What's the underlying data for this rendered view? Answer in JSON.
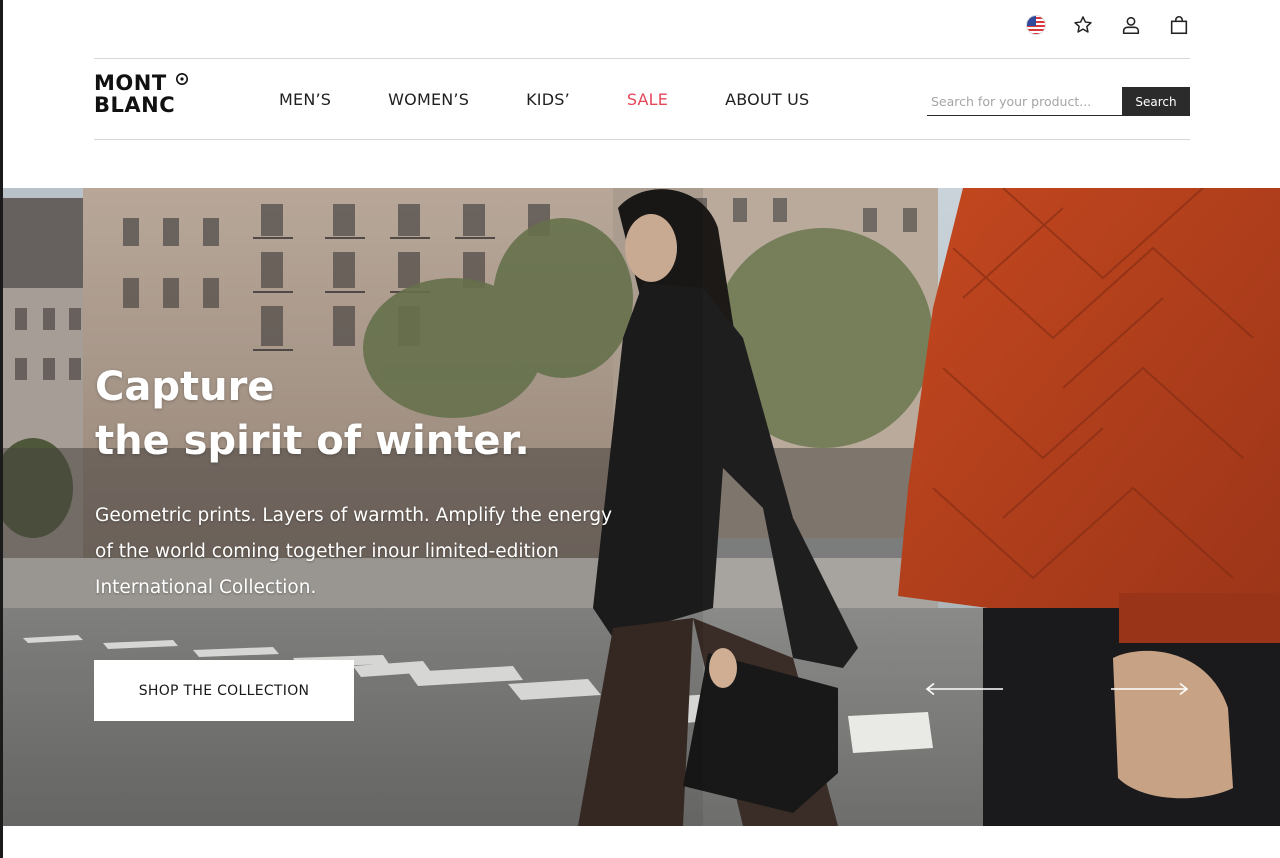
{
  "utility": {
    "icons": [
      "us-flag-icon",
      "star-icon",
      "user-icon",
      "bag-icon"
    ]
  },
  "brand": {
    "line1": "MONT",
    "line2": "BLANC"
  },
  "nav": {
    "items": [
      "MEN’S",
      "WOMEN’S",
      "KIDS’",
      "SALE",
      "ABOUT US"
    ],
    "sale_color": "#e5475a"
  },
  "search": {
    "placeholder": "Search for your product...",
    "value": "",
    "button_label": "Search"
  },
  "hero": {
    "title_line1": "Capture",
    "title_line2": "the spirit of winter.",
    "subtitle_line1": "Geometric prints. Layers of warmth. Amplify the energy",
    "subtitle_line2": "of the world coming together inour limited-edition",
    "subtitle_line3": "International Collection.",
    "cta_label": "SHOP THE COLLECTION",
    "prev_icon": "arrow-left-icon",
    "next_icon": "arrow-right-icon",
    "accent_jacket_color": "#b8401f"
  }
}
